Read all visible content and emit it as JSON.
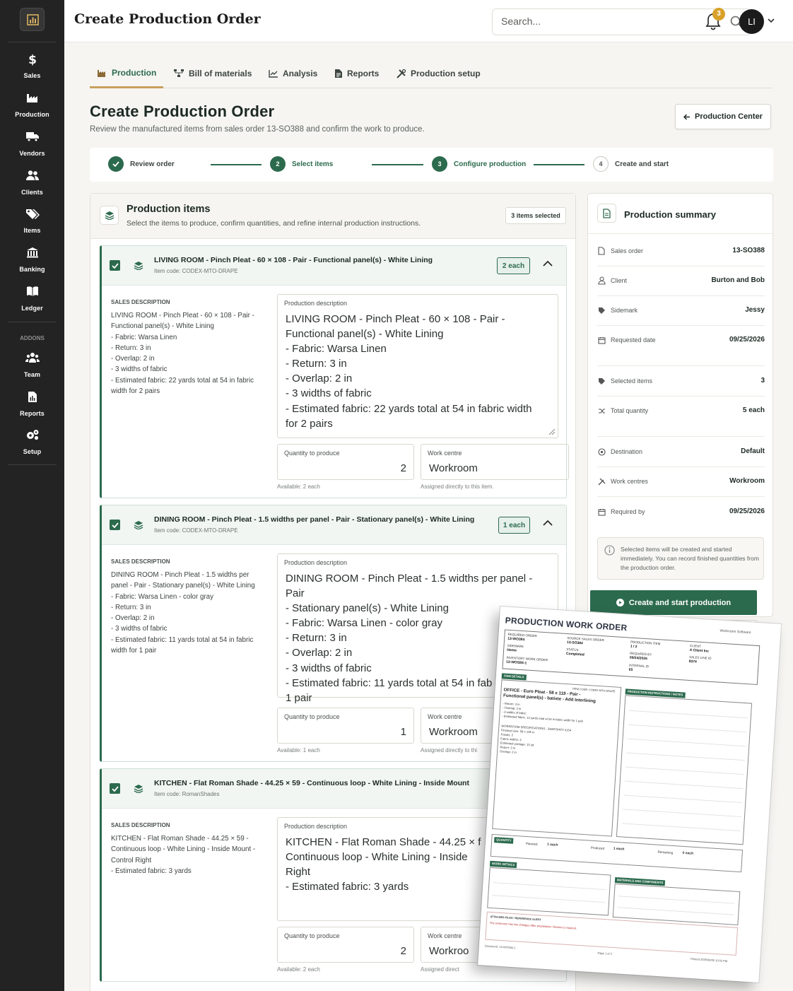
{
  "sidebar": {
    "items": [
      {
        "label": "Sales",
        "icon": "dollar-icon"
      },
      {
        "label": "Production",
        "icon": "factory-icon"
      },
      {
        "label": "Vendors",
        "icon": "truck-icon"
      },
      {
        "label": "Clients",
        "icon": "users-icon"
      },
      {
        "label": "Items",
        "icon": "tags-icon"
      },
      {
        "label": "Banking",
        "icon": "bank-icon"
      },
      {
        "label": "Ledger",
        "icon": "book-icon"
      }
    ],
    "addons_label": "ADDONS",
    "addons": [
      {
        "label": "Team",
        "icon": "team-icon"
      },
      {
        "label": "Reports",
        "icon": "report-icon"
      },
      {
        "label": "Setup",
        "icon": "gears-icon"
      }
    ]
  },
  "header": {
    "title": "Create Production Order",
    "search_placeholder": "Search...",
    "notification_count": "3",
    "avatar_initials": "LI"
  },
  "tabs": [
    {
      "label": "Production",
      "active": true
    },
    {
      "label": "Bill of materials"
    },
    {
      "label": "Analysis"
    },
    {
      "label": "Reports"
    },
    {
      "label": "Production setup"
    }
  ],
  "page": {
    "title": "Create Production Order",
    "subtitle": "Review the manufactured items from sales order 13-SO388 and confirm the work to produce.",
    "back_button": "Production Center"
  },
  "steps": [
    {
      "label": "Review order",
      "state": "done"
    },
    {
      "label": "Select items",
      "number": "2",
      "state": "done"
    },
    {
      "label": "Configure production",
      "number": "3",
      "state": "current"
    },
    {
      "label": "Create and start",
      "number": "4",
      "state": "todo"
    }
  ],
  "production_items": {
    "title": "Production items",
    "subtitle": "Select the items to produce, confirm quantities, and refine internal production instructions.",
    "selected_badge": "3 items selected",
    "sales_label": "SALES DESCRIPTION",
    "prod_label": "Production description",
    "qty_label": "Quantity to produce",
    "wc_label": "Work centre",
    "items": [
      {
        "name": "LIVING ROOM - Pinch Pleat - 60 × 108 - Pair - Functional panel(s) - White Lining",
        "code": "Item code: CODEX-MTO-DRAPE",
        "badge": "2 each",
        "sales_description": "LIVING ROOM - Pinch Pleat - 60 × 108 - Pair -\nFunctional panel(s) - White Lining\n- Fabric: Warsa Linen\n- Return: 3 in\n- Overlap: 2 in\n- 3 widths of fabric\n- Estimated fabric: 22 yards total at 54 in fabric\nwidth for 2 pairs",
        "production_description": "LIVING ROOM - Pinch Pleat - 60 × 108 - Pair -\nFunctional panel(s) - White Lining\n- Fabric: Warsa Linen\n- Return: 3 in\n- Overlap: 2 in\n- 3 widths of fabric\n- Estimated fabric: 22 yards total at 54 in fabric width\nfor 2 pairs",
        "quantity": "2",
        "available": "Available: 2 each",
        "work_centre": "Workroom",
        "wc_hint": "Assigned directly to this item."
      },
      {
        "name": "DINING ROOM - Pinch Pleat - 1.5 widths per panel - Pair - Stationary panel(s) - White Lining",
        "code": "Item code: CODEX-MTO-DRAPE",
        "badge": "1 each",
        "sales_description": "DINING ROOM - Pinch Pleat - 1.5 widths per\npanel - Pair - Stationary panel(s) - White Lining\n- Fabric: Warsa Linen - color gray\n- Return: 3 in\n- Overlap: 2 in\n- 3 widths of fabric\n- Estimated fabric: 11 yards total at 54 in fabric\nwidth for 1 pair",
        "production_description": "DINING ROOM - Pinch Pleat - 1.5 widths per panel - Pair\n- Stationary panel(s) - White Lining\n- Fabric: Warsa Linen - color gray\n- Return: 3 in\n- Overlap: 2 in\n- 3 widths of fabric\n- Estimated fabric: 11 yards total at 54 in fab\n1 pair",
        "quantity": "1",
        "available": "Available: 1 each",
        "work_centre": "Workroom",
        "wc_hint": "Assigned directly to thi"
      },
      {
        "name": "KITCHEN - Flat Roman Shade - 44.25 × 59 - Continuous loop - White Lining - Inside Mount",
        "code": "Item code: RomanShades",
        "badge": "",
        "sales_description": "KITCHEN - Flat Roman Shade - 44.25 × 59 -\nContinuous loop - White Lining - Inside Mount -\nControl Right\n- Estimated fabric: 3 yards",
        "production_description": "KITCHEN - Flat Roman Shade - 44.25 × f\nContinuous loop - White Lining - Inside\nRight\n- Estimated fabric: 3 yards",
        "quantity": "2",
        "available": "Available: 2 each",
        "work_centre": "Workroo",
        "wc_hint": "Assigned direct"
      }
    ]
  },
  "summary": {
    "title": "Production summary",
    "rows": [
      {
        "key": "Sales order",
        "value": "13-SO388",
        "icon": "document-icon"
      },
      {
        "key": "Client",
        "value": "Burton and Bob",
        "icon": "user-icon"
      },
      {
        "key": "Sidemark",
        "value": "Jessy",
        "icon": "tag-icon"
      },
      {
        "key": "Requested date",
        "value": "09/25/2026",
        "icon": "calendar-icon"
      },
      {
        "key": "Selected items",
        "value": "3",
        "icon": "tag-icon"
      },
      {
        "key": "Total quantity",
        "value": "5 each",
        "icon": "shuffle-icon"
      },
      {
        "key": "Destination",
        "value": "Default",
        "icon": "target-icon"
      },
      {
        "key": "Work centres",
        "value": "Workroom",
        "icon": "tools-icon"
      },
      {
        "key": "Required by",
        "value": "09/25/2026",
        "icon": "calendar-icon"
      }
    ],
    "note": "Selected items will be created and started immediately. You can record finished quantities from the production order.",
    "cta": "Create and start production"
  },
  "work_order": {
    "title": "PRODUCTION WORK ORDER",
    "brand": "Workroom Software",
    "grid": [
      {
        "k": "REQUIRED ORDER",
        "v": "13-WO384"
      },
      {
        "k": "SOURCE SALES ORDER",
        "v": "13-SO384"
      },
      {
        "k": "PRODUCTION ITEM",
        "v": "1 / 2"
      },
      {
        "k": "CLIENT",
        "v": "A Client Inc"
      },
      {
        "k": "SIDEMARK",
        "v": "Home"
      },
      {
        "k": "STATUS",
        "v": "Completed"
      },
      {
        "k": "REQUIRED BY",
        "v": "09/24/2026"
      },
      {
        "k": "SALES LINE ID",
        "v": "8374"
      },
      {
        "k": "INVENTORY WORK ORDER",
        "v": "13-WOS84-1"
      },
      {
        "k": "INTERNAL ID",
        "v": "65"
      }
    ],
    "item_details_tag": "ITEM DETAILS",
    "item_code": "ITEM CODE: CODEX-MTO-DRAPE",
    "item_name": "OFFICE - Euro Pleat - 58 x 119 - Pair -\nFunctional panel(s) - batiste - Add Interlining",
    "item_specs": "- Return: 3 in\n- Overlap: 2 in\n- 3 widths of fabric\n- Estimated fabric: 12 yards total at 54 in fabric width for 1 pair",
    "workroom_specs": "WORKROOM SPECIFICATIONS - SNAPSHOT #154\nFinished size: 58 x 119 in\nPanels: 2\nFabric widths: 3\nEstimated yardage: 12 yd\nReturn: 3 in\nOverlap: 2 in",
    "instructions_tag": "PRODUCTION INSTRUCTIONS / NOTES",
    "quantity_tag": "QUANTITY",
    "planned_label": "Planned",
    "planned": "1 each",
    "produced_label": "Produced",
    "produced": "1 each",
    "remaining_label": "Remaining",
    "remaining": "0 each",
    "work_details_tag": "WORK DETAILS",
    "materials_tag": "MATERIALS AND COMPONENTS",
    "attached_label": "ATTACHED FILES / REFERENCE ALERT",
    "attached_note": "The workroom has line changes after preparation. Review is required.",
    "footer_left": "Document: 13-WOS84-1",
    "footer_mid": "Page 1 of 2",
    "footer_right": "Printed 2026/09/26 10:02 PM"
  }
}
